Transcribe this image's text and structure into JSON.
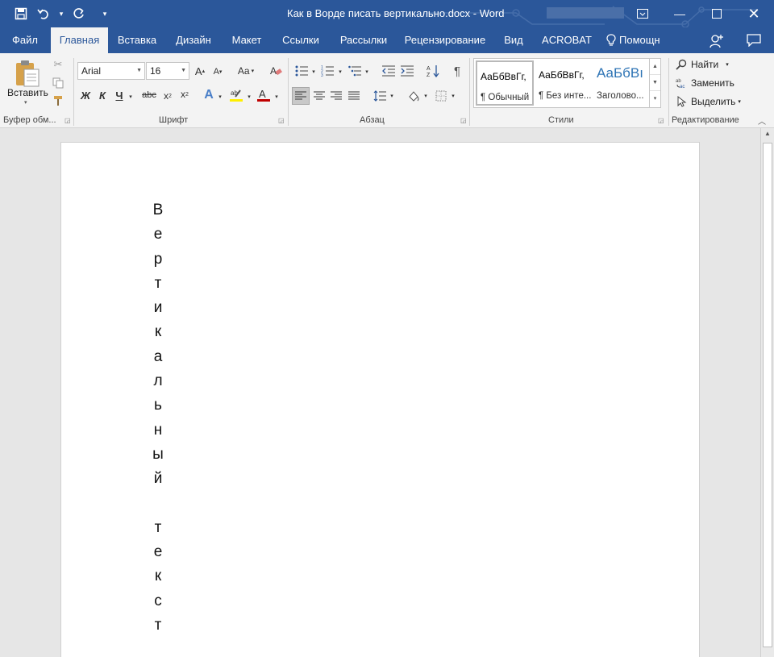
{
  "window": {
    "title": "Как в Ворде писать вертикально.docx - Word",
    "accent_color": "#2b579a"
  },
  "quick_access": {
    "save_icon": "save-icon",
    "undo_icon": "undo-icon",
    "redo_icon": "redo-icon",
    "customize_icon": "customize-qat-icon"
  },
  "tabs": [
    {
      "label": "Файл"
    },
    {
      "label": "Главная"
    },
    {
      "label": "Вставка"
    },
    {
      "label": "Дизайн"
    },
    {
      "label": "Макет"
    },
    {
      "label": "Ссылки"
    },
    {
      "label": "Рассылки"
    },
    {
      "label": "Рецензирование"
    },
    {
      "label": "Вид"
    },
    {
      "label": "ACROBAT"
    },
    {
      "label": "Помощн"
    }
  ],
  "ribbon": {
    "clipboard": {
      "label": "Буфер обм...",
      "paste_label": "Вставить"
    },
    "font": {
      "label": "Шрифт",
      "font_name": "Arial",
      "font_size": "16",
      "bold": "Ж",
      "italic": "К",
      "underline": "Ч",
      "strike": "abc",
      "change_case": "Aa"
    },
    "paragraph": {
      "label": "Абзац"
    },
    "styles": {
      "label": "Стили",
      "items": [
        {
          "sample": "АаБбВвГг,",
          "name": "¶ Обычный"
        },
        {
          "sample": "АаБбВвГг,",
          "name": "¶ Без инте..."
        },
        {
          "sample": "АаБбВı",
          "name": "Заголово..."
        }
      ]
    },
    "editing": {
      "label": "Редактирование",
      "find": "Найти",
      "replace": "Заменить",
      "select": "Выделить"
    }
  },
  "document": {
    "letters": [
      "В",
      "е",
      "р",
      "т",
      "и",
      "к",
      "а",
      "л",
      "ь",
      "н",
      "ы",
      "й",
      "",
      "т",
      "е",
      "к",
      "с",
      "т"
    ]
  }
}
